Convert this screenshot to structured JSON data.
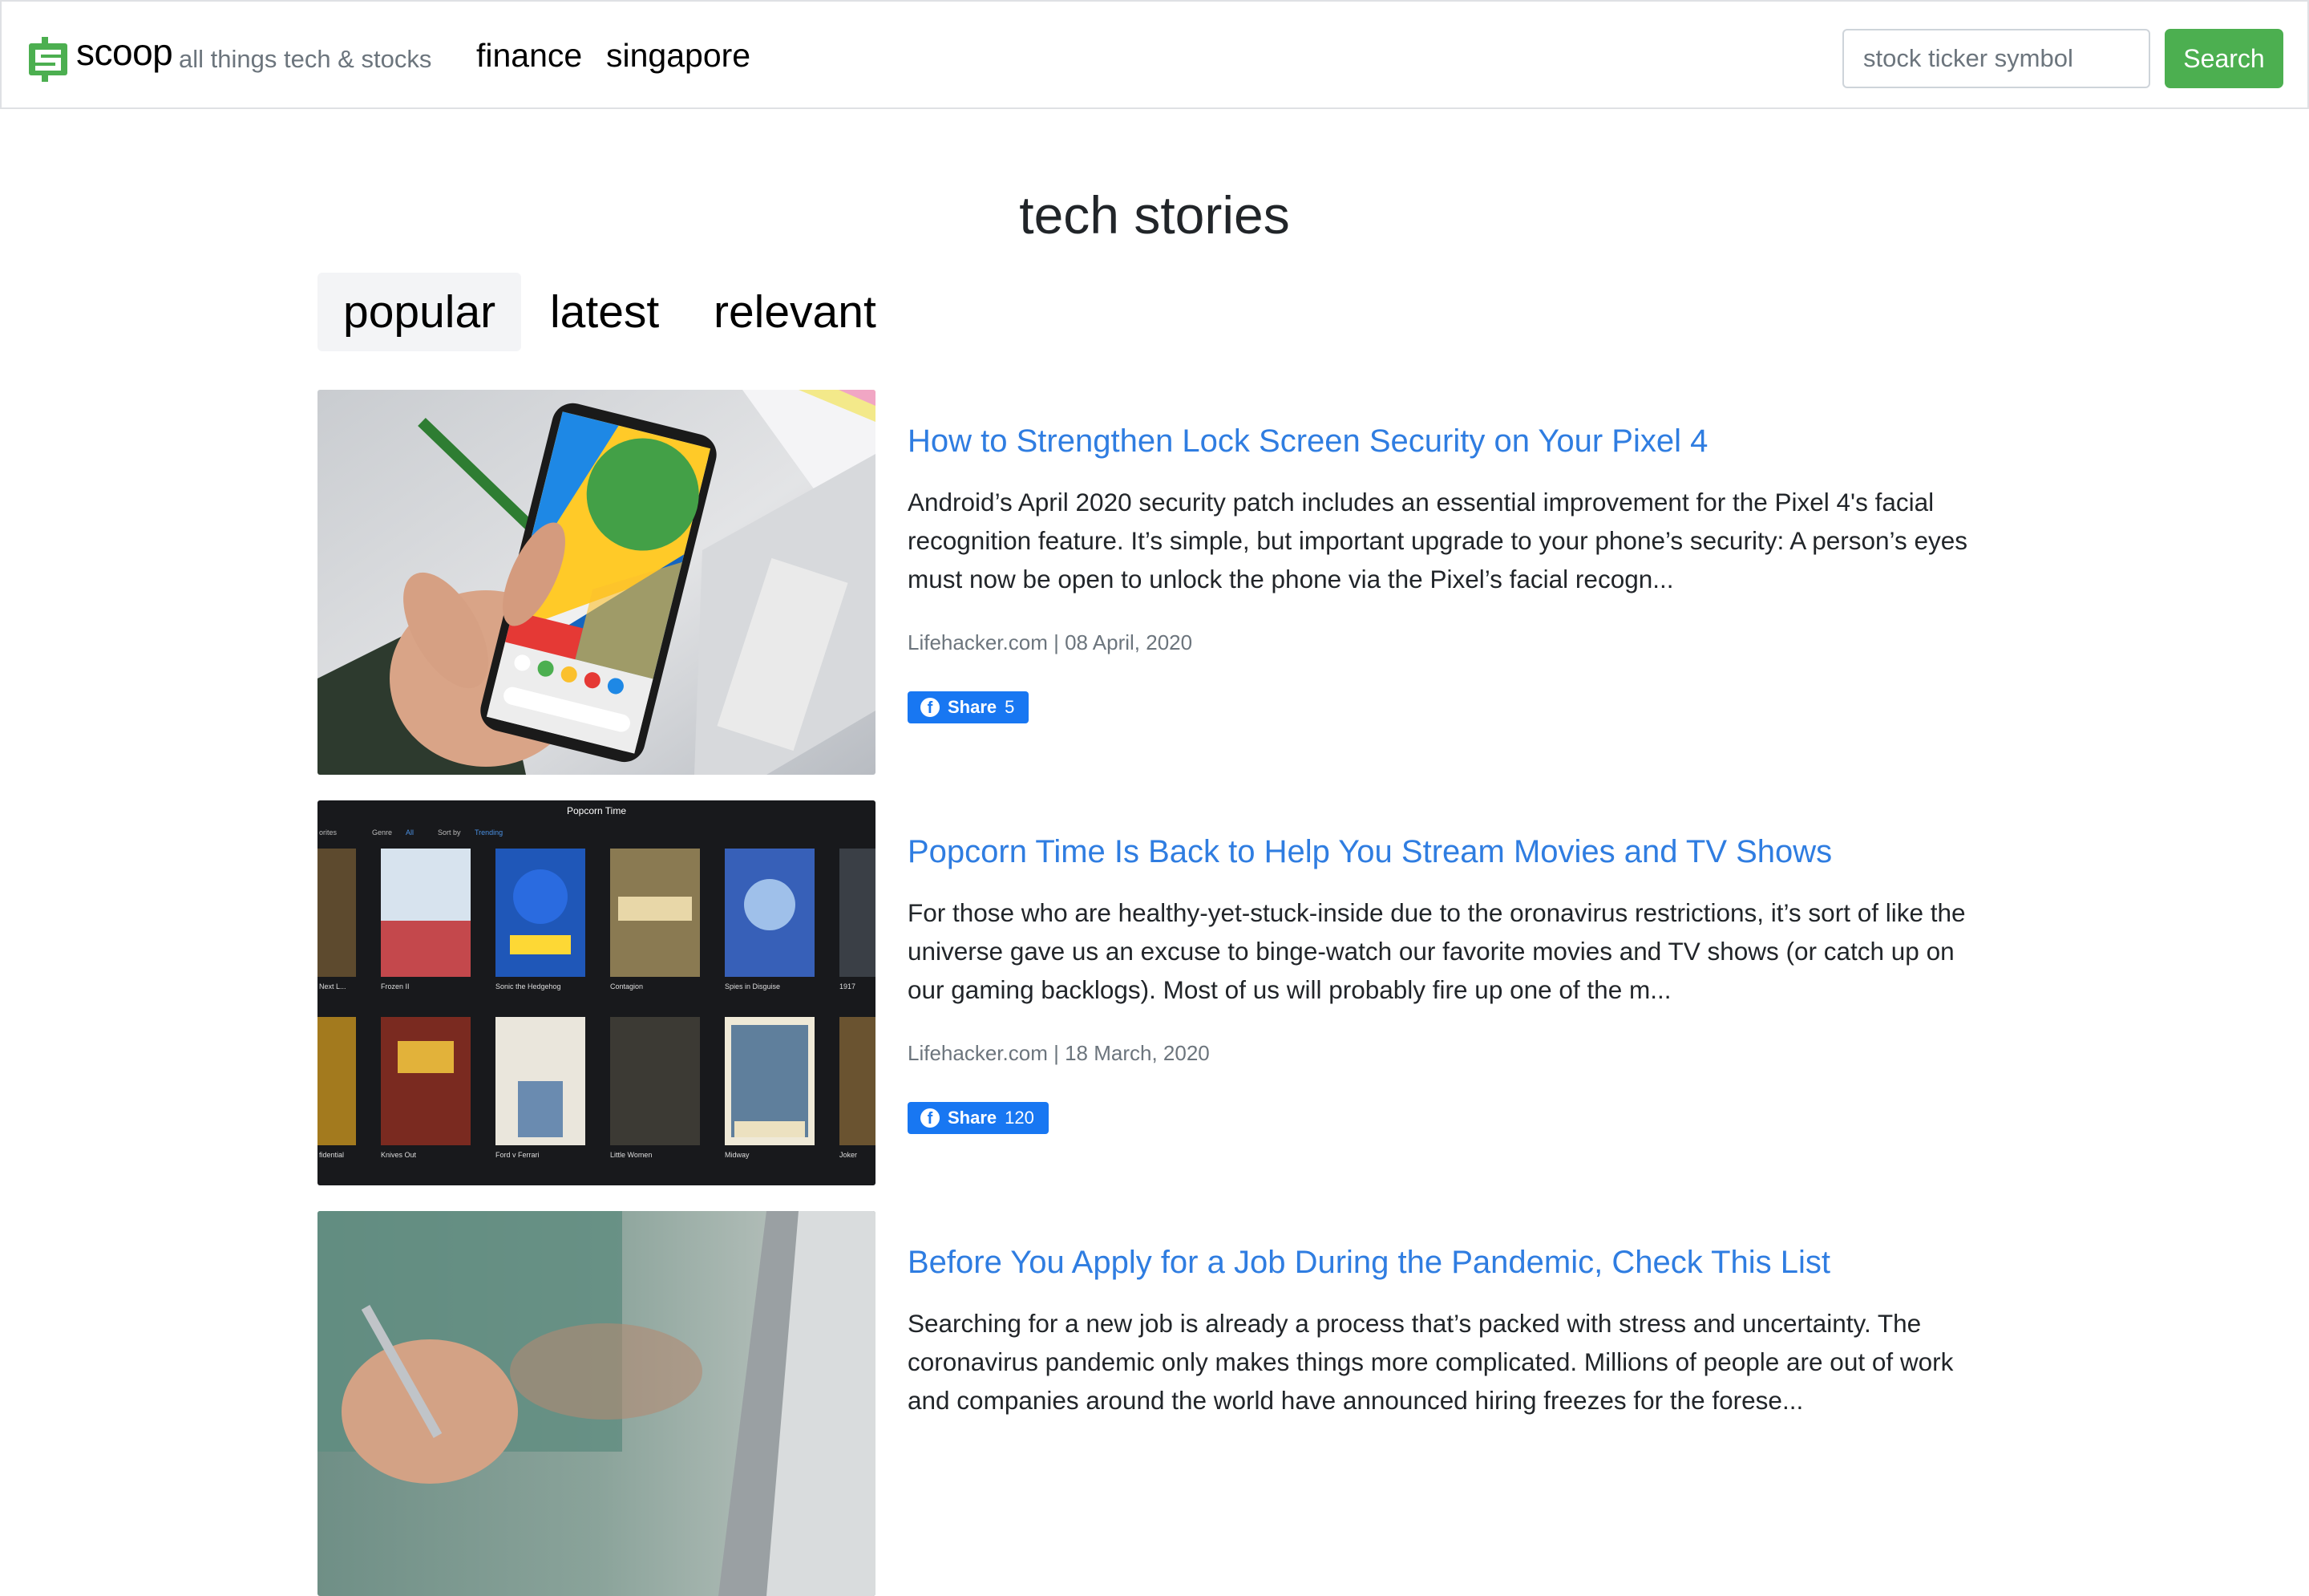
{
  "header": {
    "brand_name": "scoop",
    "tagline": "all things tech & stocks",
    "nav": [
      {
        "label": "finance"
      },
      {
        "label": "singapore"
      }
    ],
    "search": {
      "placeholder": "stock ticker symbol",
      "value": "",
      "button_label": "Search"
    }
  },
  "page": {
    "title": "tech stories",
    "tabs": [
      {
        "label": "popular",
        "active": true
      },
      {
        "label": "latest",
        "active": false
      },
      {
        "label": "relevant",
        "active": false
      }
    ]
  },
  "articles": [
    {
      "title": "How to Strengthen Lock Screen Security on Your Pixel 4",
      "excerpt": "Android’s April 2020 security patch includes an essential improvement for the Pixel 4's facial recognition feature. It’s simple, but important upgrade to your phone’s security: A person’s eyes must now be open to unlock the phone via the Pixel’s facial recogn...",
      "meta": "Lifehacker.com | 08 April, 2020",
      "share_label": "Share",
      "share_count": "5",
      "image": "hand-holding-pixel-phone"
    },
    {
      "title": "Popcorn Time Is Back to Help You Stream Movies and TV Shows",
      "excerpt": "For those who are healthy-yet-stuck-inside due to the oronavirus restrictions, it’s sort of like the universe gave us an excuse to binge-watch our favorite movies and TV shows (or catch up on our gaming backlogs). Most of us will probably fire up one of the m...",
      "meta": "Lifehacker.com | 18 March, 2020",
      "share_label": "Share",
      "share_count": "120",
      "image": "popcorn-time-movie-grid",
      "screenshot_text": {
        "app_title": "Popcorn Time",
        "tab_fragment": "orites",
        "genre_label": "Genre",
        "genre_value": "All",
        "sort_label": "Sort by",
        "sort_value": "Trending",
        "row1": [
          "Next L...",
          "Frozen II",
          "Sonic the Hedgehog",
          "Contagion",
          "Spies in Disguise",
          "1917"
        ],
        "row2": [
          "fidential",
          "Knives Out",
          "Ford v Ferrari",
          "Little Women",
          "Midway",
          "Joker"
        ]
      }
    },
    {
      "title": "Before You Apply for a Job During the Pandemic, Check This List",
      "excerpt": "Searching for a new job is already a process that’s packed with stress and uncertainty. The coronavirus pandemic only makes things more complicated. Millions of people are out of work and companies around the world have announced hiring freezes for the forese...",
      "meta": "",
      "share_label": "",
      "share_count": "",
      "image": "person-writing-at-laptop"
    }
  ],
  "colors": {
    "brand_green": "#4caf50",
    "link_blue": "#2f7de1",
    "facebook_blue": "#1877f2",
    "muted_text": "#6c757d"
  }
}
